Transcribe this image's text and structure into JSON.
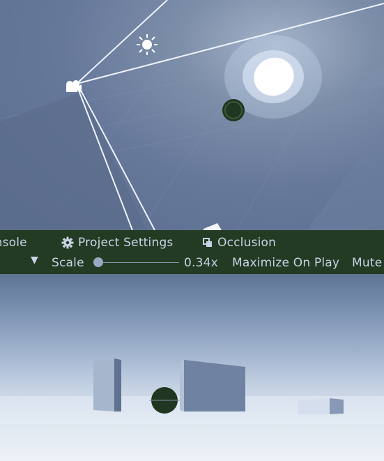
{
  "toolbar": {
    "tabs": [
      {
        "label": "Console",
        "visible_label": "onsole",
        "icon": "console-icon"
      },
      {
        "label": "Project Settings",
        "icon": "gear-icon"
      },
      {
        "label": "Occlusion",
        "icon": "occlusion-icon"
      }
    ],
    "display_dropdown": {
      "visible_text": ")",
      "icon": "dropdown-arrow-icon"
    },
    "scale": {
      "label": "Scale",
      "value_text": "0.34x",
      "value": 0.34,
      "slider_fraction": 0.0
    },
    "maximize_on_play": "Maximize On Play",
    "mute_visible": "Mute"
  },
  "scene_icons": [
    "sun-icon",
    "camera-icon",
    "light-glow",
    "sphere"
  ],
  "colors": {
    "toolbar_bg": "#233a23",
    "toolbar_text": "#c9d3e6",
    "object_green": "#203620"
  }
}
